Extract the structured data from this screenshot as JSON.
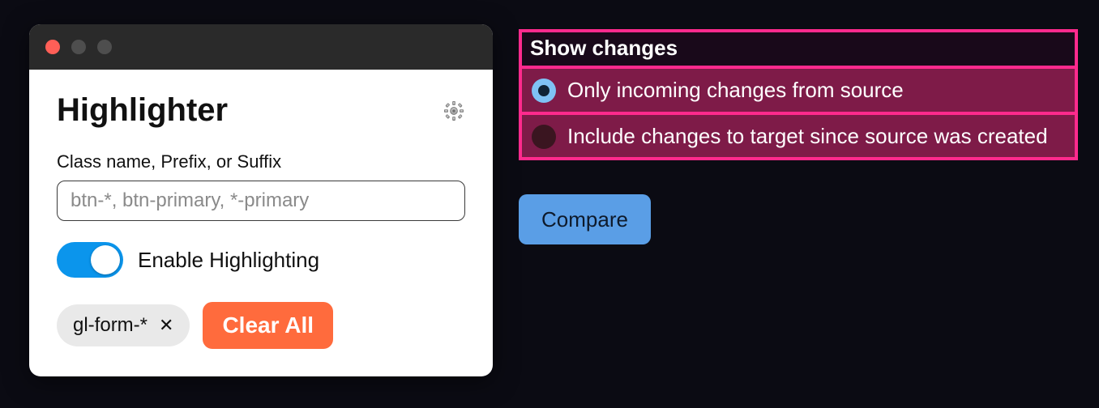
{
  "highlighter": {
    "title": "Highlighter",
    "field_label": "Class name, Prefix, or Suffix",
    "input_placeholder": "btn-*, btn-primary, *-primary",
    "toggle_label": "Enable Highlighting",
    "toggle_on": true,
    "chip_label": "gl-form-*",
    "clear_label": "Clear All"
  },
  "changes": {
    "title": "Show changes",
    "options": [
      {
        "label": "Only incoming changes from source",
        "selected": true
      },
      {
        "label": "Include changes to target since source was created",
        "selected": false
      }
    ]
  },
  "compare_label": "Compare"
}
